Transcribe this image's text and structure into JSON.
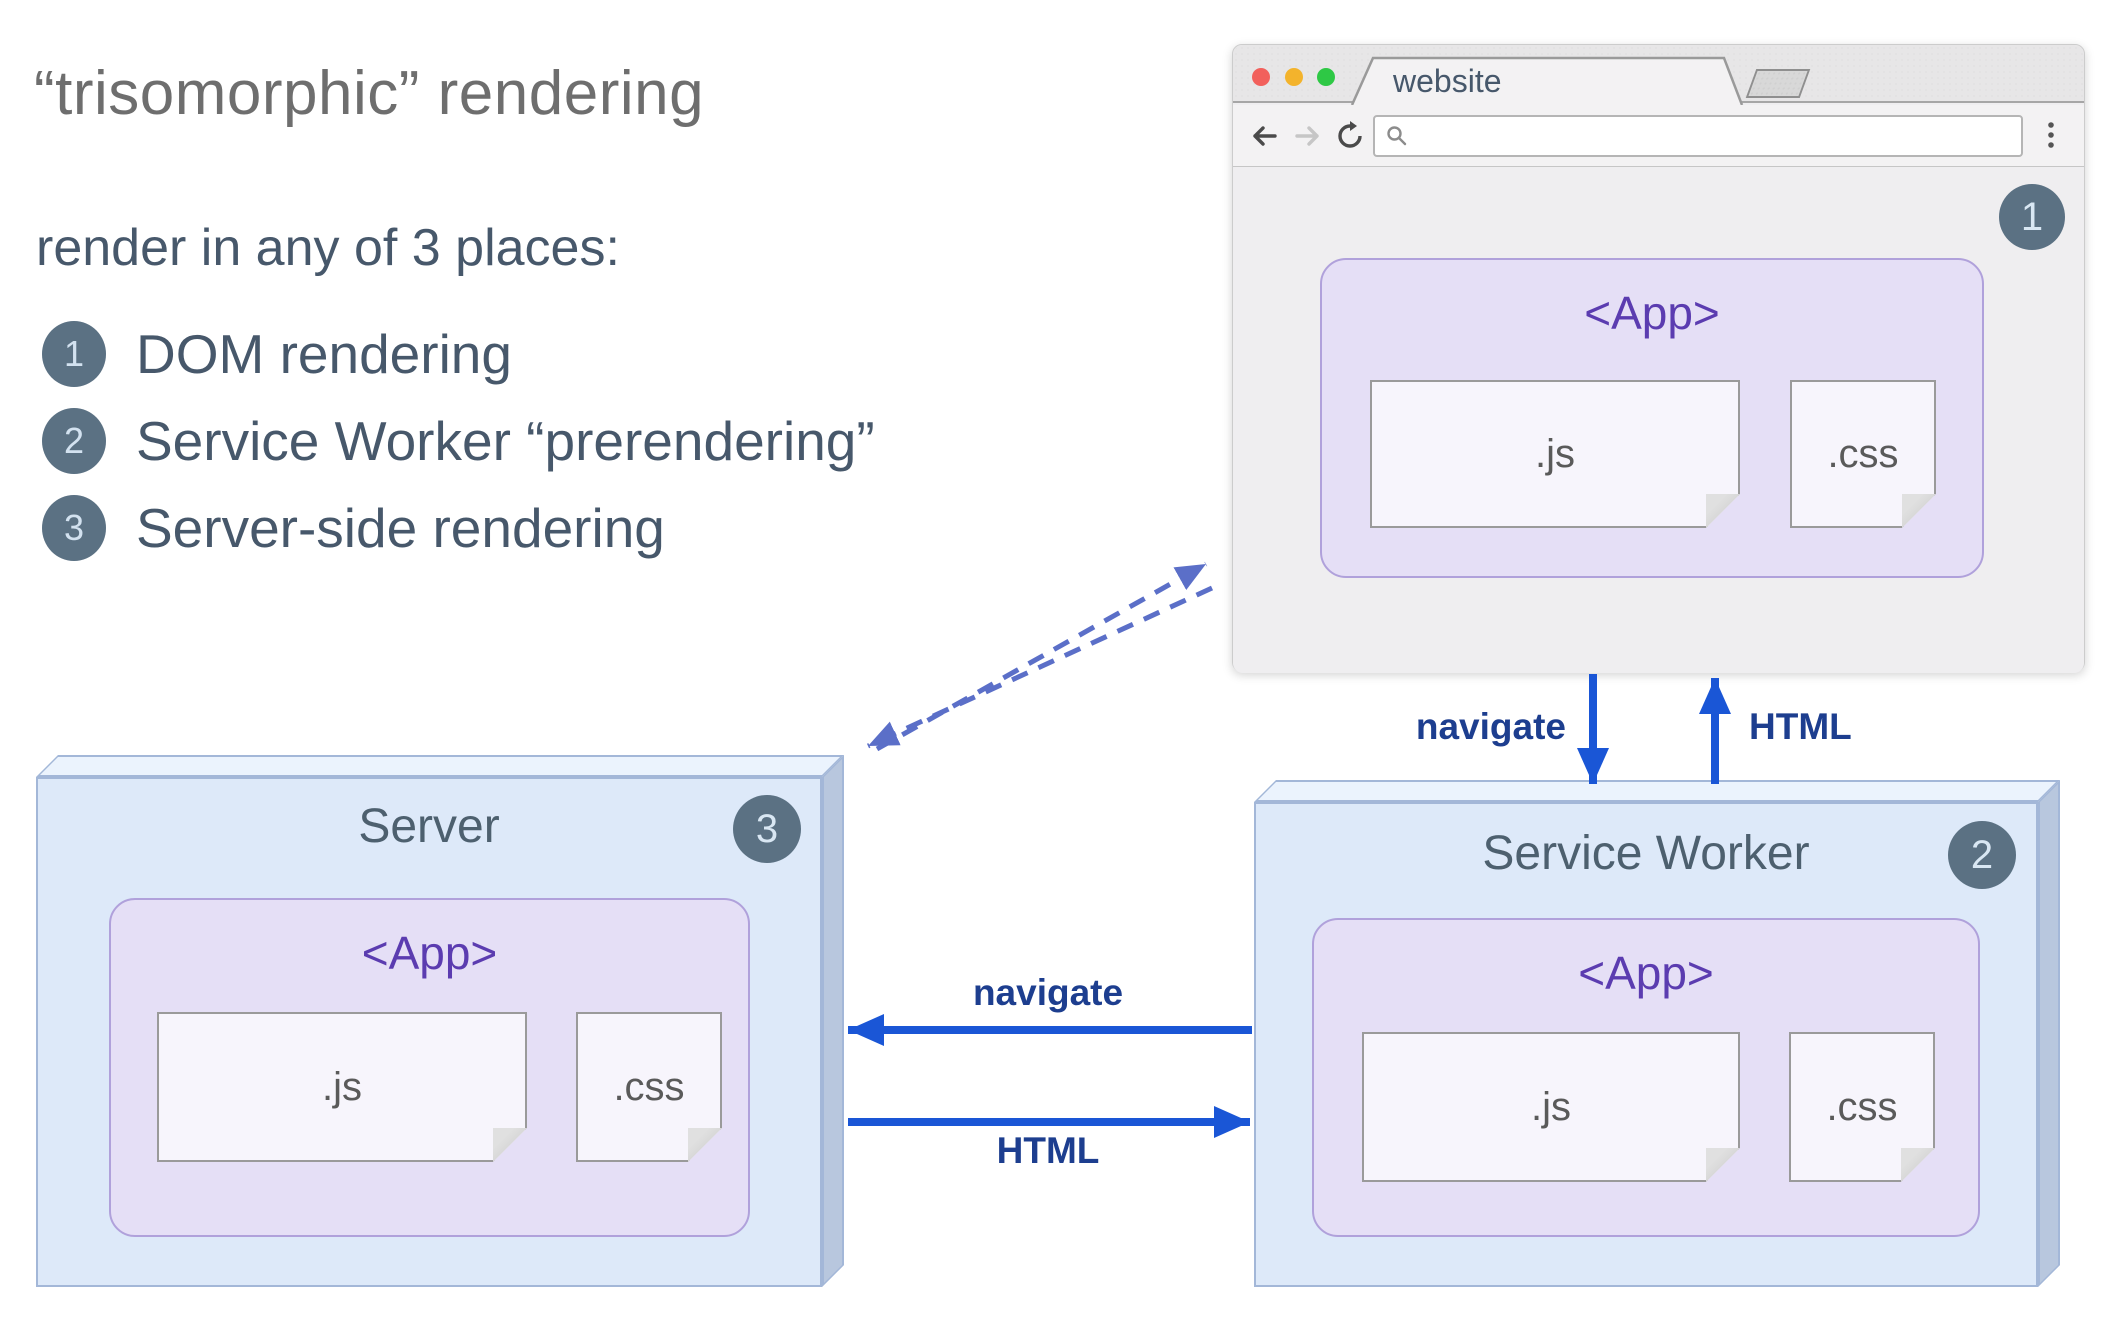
{
  "page": {
    "title": "“trisomorphic” rendering",
    "subtitle": "render in any of 3 places:"
  },
  "legend": {
    "items": [
      {
        "num": "1",
        "label": "DOM rendering"
      },
      {
        "num": "2",
        "label": "Service Worker “prerendering”"
      },
      {
        "num": "3",
        "label": "Server-side rendering"
      }
    ]
  },
  "browser": {
    "tab_title": "website",
    "badge": "1",
    "url_value": "",
    "app": {
      "label": "<App>",
      "js": ".js",
      "css": ".css"
    }
  },
  "server": {
    "title": "Server",
    "badge": "3",
    "app": {
      "label": "<App>",
      "js": ".js",
      "css": ".css"
    }
  },
  "service_worker": {
    "title": "Service Worker",
    "badge": "2",
    "app": {
      "label": "<App>",
      "js": ".js",
      "css": ".css"
    }
  },
  "arrows": {
    "browser_to_sw": "navigate",
    "sw_to_browser": "HTML",
    "sw_to_server": "navigate",
    "server_to_sw": "HTML"
  },
  "colors": {
    "arrow_blue": "#1a56d6",
    "dashed_indigo": "#5b6fc8",
    "badge_slate": "#5b7183",
    "app_purple": "#5b3cb0",
    "box_blue": "#dde9f9",
    "app_lavender": "#e5dff6"
  }
}
